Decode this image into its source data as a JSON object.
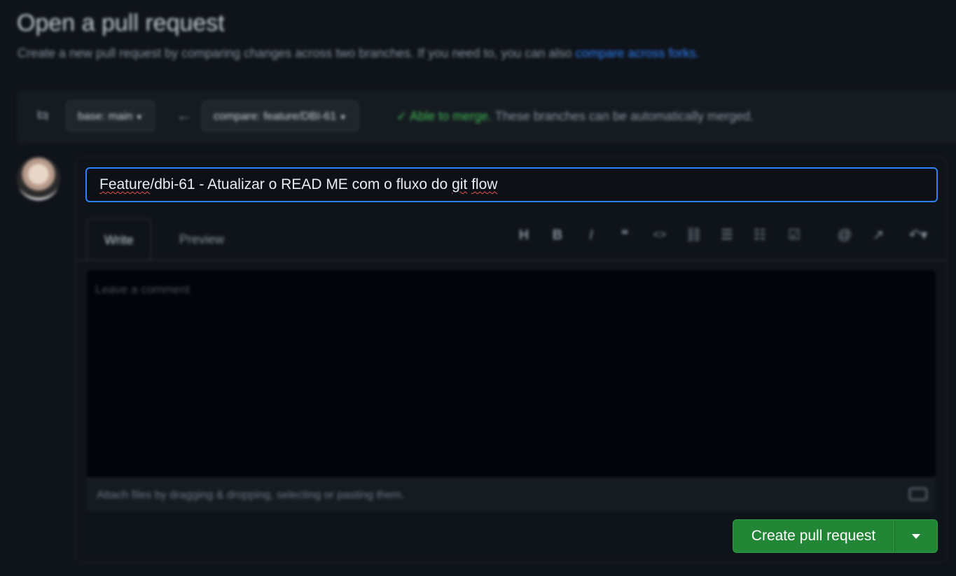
{
  "header": {
    "title": "Open a pull request",
    "subtitle": "Create a new pull request by comparing changes across two branches. If you need to, you can also",
    "subtitle_link": "compare across forks."
  },
  "compare": {
    "base_label": "base: main",
    "compare_label": "compare: feature/DBI-61",
    "merge_ok": "Able to merge.",
    "merge_detail": "These branches can be automatically merged."
  },
  "form": {
    "title_value": {
      "part1": "Feature",
      "part2": "/dbi-61 - Atualizar o READ ME com o fluxo do ",
      "part3": "git",
      "part4": " ",
      "part5": "flow"
    },
    "tabs": [
      "Write",
      "Preview"
    ],
    "comment_placeholder": "Leave a comment",
    "attach_text": "Attach files by dragging & dropping, selecting or pasting them.",
    "submit_label": "Create pull request"
  },
  "toolbar_icons": [
    "heading-icon",
    "bold-icon",
    "italic-icon",
    "quote-icon",
    "code-icon",
    "link-icon",
    "ordered-list-icon",
    "unordered-list-icon",
    "tasklist-icon",
    "mention-icon",
    "reference-icon",
    "reply-icon"
  ],
  "colors": {
    "accent_blue": "#2f81f7",
    "success_green": "#238636",
    "background": "#0f131a"
  }
}
